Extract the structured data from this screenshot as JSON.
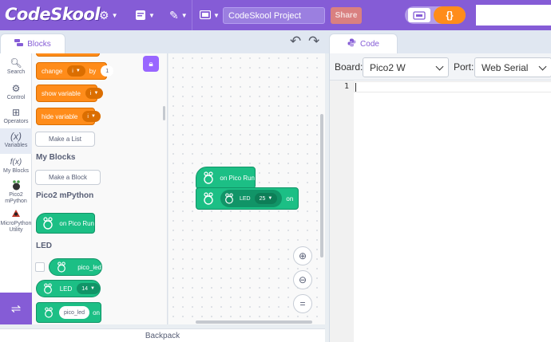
{
  "app": {
    "logo": "CodeSkool",
    "project_title": "CodeSkool Project",
    "share_label": "Share",
    "code_toggle_label": "{}"
  },
  "tabs": {
    "blocks_label": "Blocks",
    "code_label": "Code"
  },
  "categories": [
    {
      "label": "Search",
      "icon": "search-icon"
    },
    {
      "label": "Control",
      "icon": "control-icon"
    },
    {
      "label": "Operators",
      "icon": "operators-icon"
    },
    {
      "label": "Variables",
      "icon": "variables-icon",
      "glyph": "(x)"
    },
    {
      "label": "My Blocks",
      "icon": "my-blocks-icon",
      "glyph": "f(x)"
    },
    {
      "label": "Pico2 mPython",
      "icon": "raspberry-icon"
    },
    {
      "label": "MicroPython Utility",
      "icon": "micropython-icon"
    }
  ],
  "palette": {
    "change_label": "change",
    "change_var": "i",
    "change_by": "by",
    "change_value": "1",
    "show_variable_label": "show variable",
    "show_var": "i",
    "hide_variable_label": "hide variable",
    "hide_var": "i",
    "make_list_label": "Make a List",
    "my_blocks_heading": "My Blocks",
    "make_block_label": "Make a Block",
    "pico_heading": "Pico2 mPython",
    "on_pico_run_label": "on Pico Run",
    "led_heading": "LED",
    "pico_led_reporter": "pico_led",
    "led_label": "LED",
    "led_value": "14",
    "pico_led_input": "pico_led",
    "on_label": "on"
  },
  "workspace": {
    "hat_label": "on Pico Run",
    "led_label": "LED",
    "led_value": "25",
    "on_label": "on"
  },
  "code": {
    "board_label": "Board:",
    "board_value": "Pico2 W",
    "port_label": "Port:",
    "port_value": "Web Serial",
    "line_number": "1"
  },
  "backpack_label": "Backpack",
  "colors": {
    "menu": "#855cd6",
    "orange_block": "#ff8c1a",
    "pico_block": "#1cbf85"
  }
}
